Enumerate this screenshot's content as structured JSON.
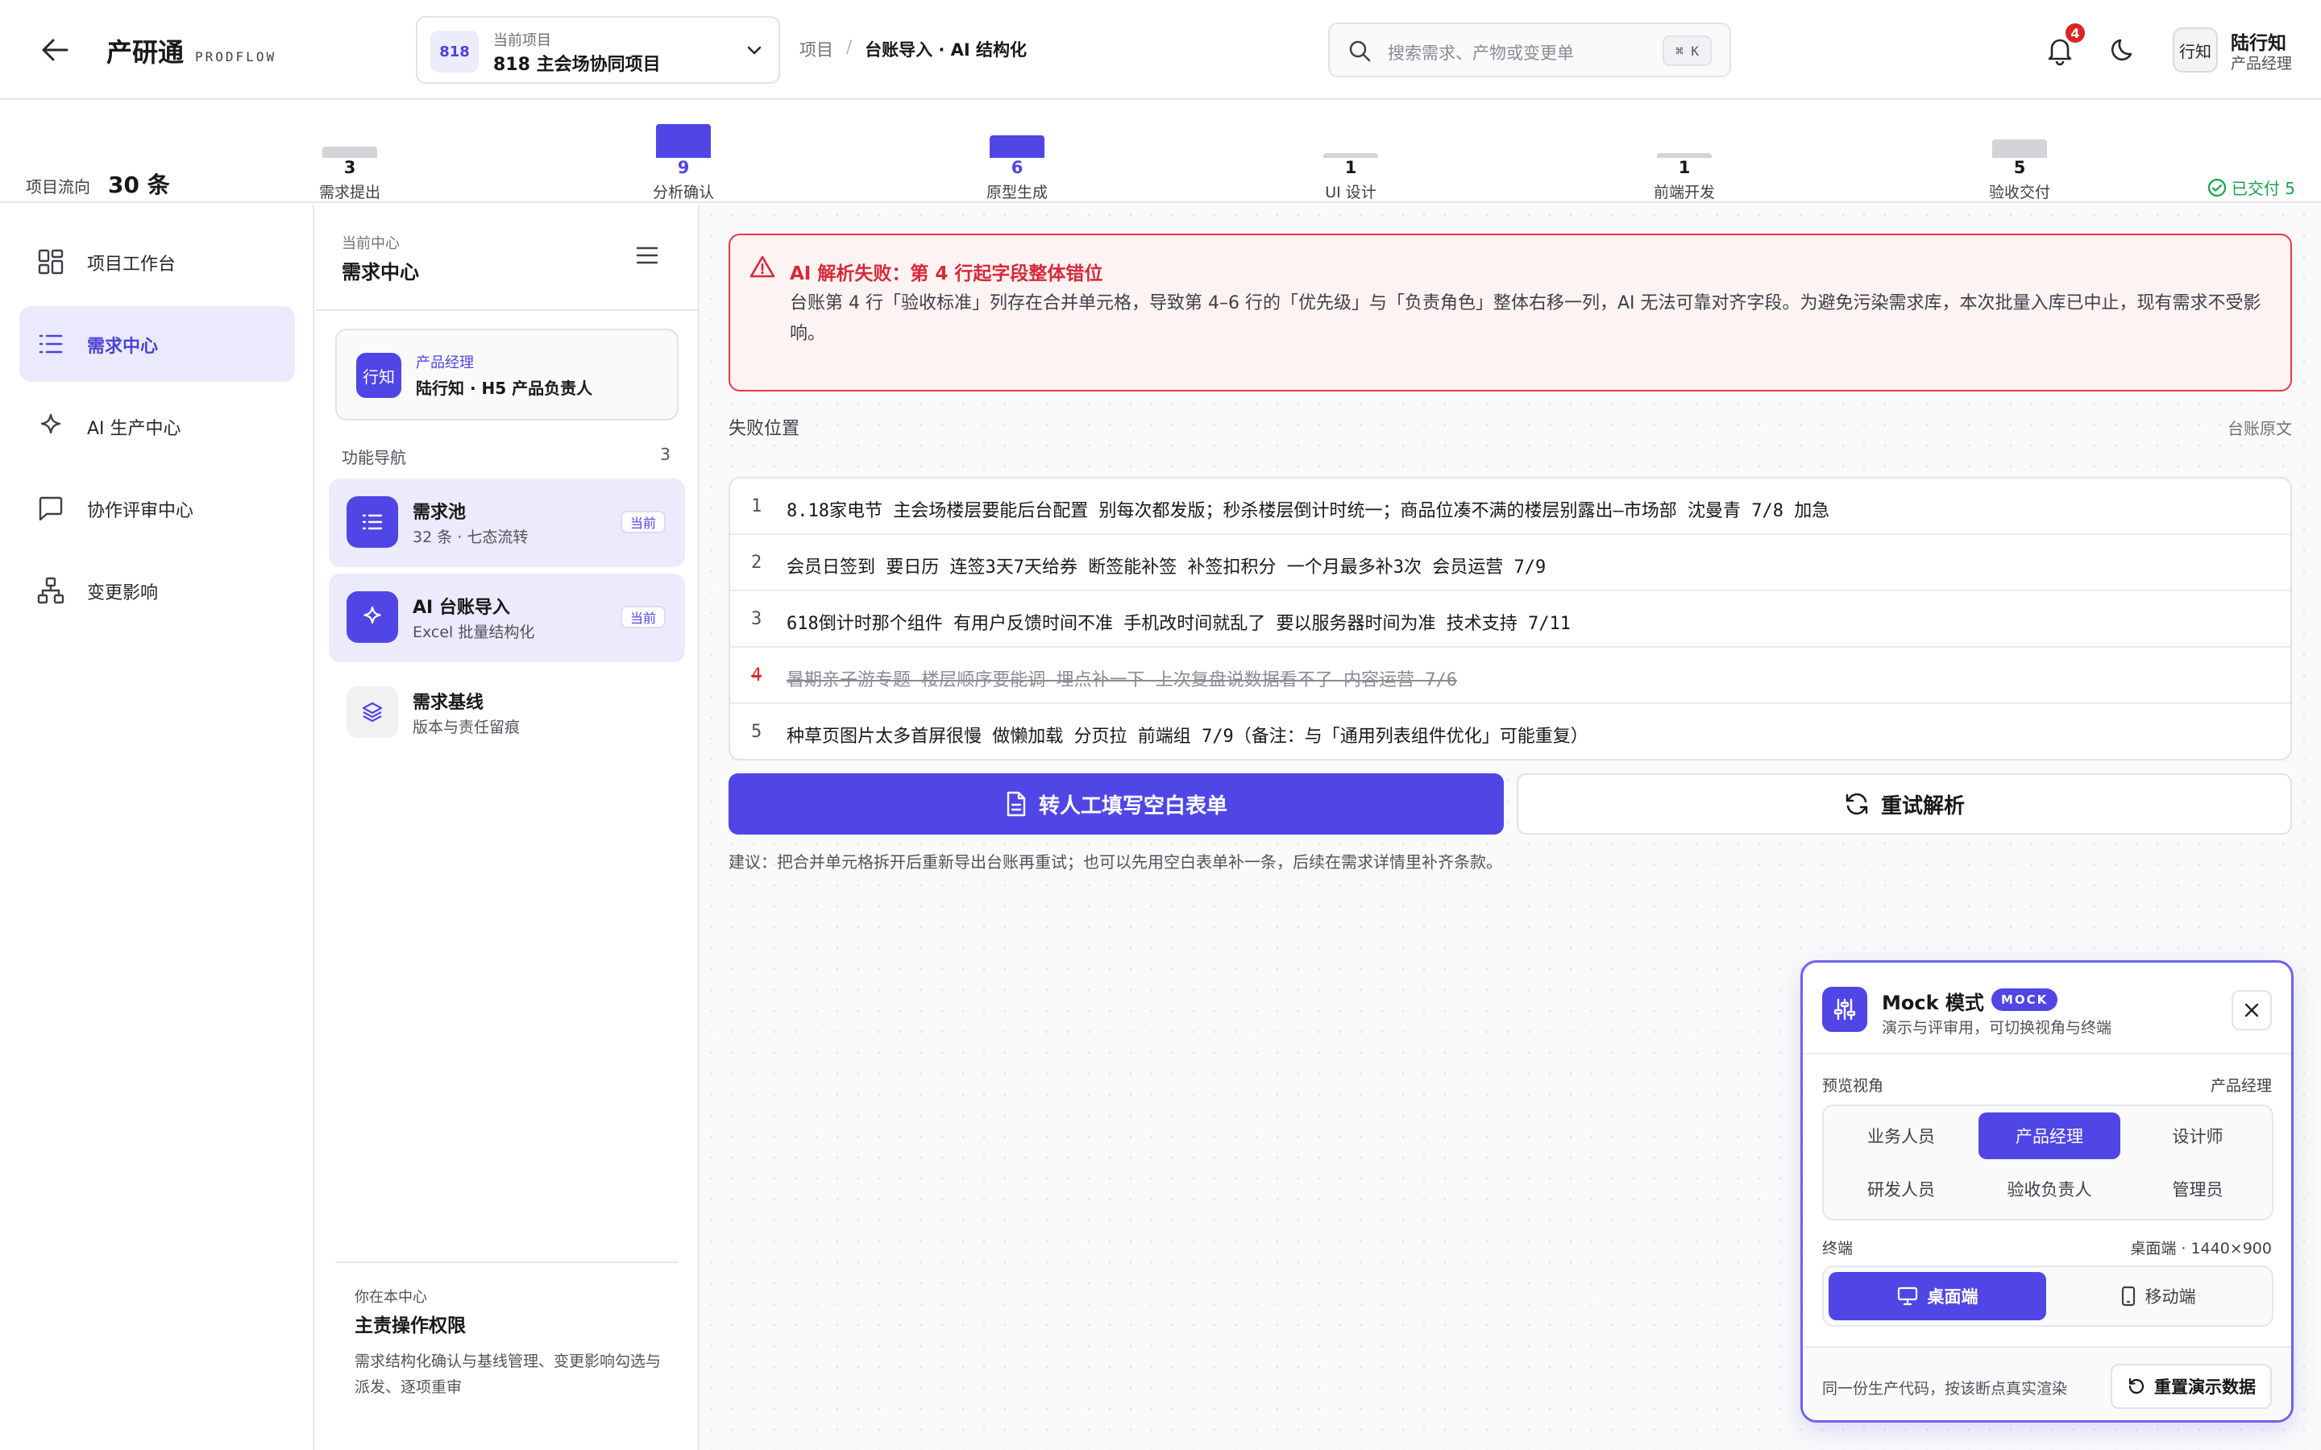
{
  "header": {
    "brand_name": "产研通",
    "brand_sub": "PRODFLOW",
    "project": {
      "badge": "818",
      "label": "当前项目",
      "name": "818 主会场协同项目"
    },
    "breadcrumb": {
      "root": "项目",
      "sep": "/",
      "current": "台账导入 · AI 结构化"
    },
    "search": {
      "placeholder": "搜索需求、产物或变更单",
      "shortcut": "⌘ K"
    },
    "notifications": "4",
    "user": {
      "avatar": "行知",
      "name": "陆行知",
      "role": "产品经理"
    }
  },
  "flow": {
    "title": "项目流向",
    "total": "30 条",
    "stages": [
      {
        "label": "需求提出",
        "count": 3,
        "active": false
      },
      {
        "label": "分析确认",
        "count": 9,
        "active": true
      },
      {
        "label": "原型生成",
        "count": 6,
        "active": true
      },
      {
        "label": "UI 设计",
        "count": 1,
        "active": false
      },
      {
        "label": "前端开发",
        "count": 1,
        "active": false
      },
      {
        "label": "验收交付",
        "count": 5,
        "active": false
      }
    ],
    "delivered": "已交付 5"
  },
  "leftnav": {
    "items": [
      {
        "label": "项目工作台",
        "icon": "dashboard-icon"
      },
      {
        "label": "需求中心",
        "icon": "list-icon"
      },
      {
        "label": "AI 生产中心",
        "icon": "sparkle-icon"
      },
      {
        "label": "协作评审中心",
        "icon": "chat-icon"
      },
      {
        "label": "变更影响",
        "icon": "network-icon"
      }
    ]
  },
  "subnav": {
    "current_label": "当前中心",
    "current_title": "需求中心",
    "role_card": {
      "avatar": "行知",
      "role": "产品经理",
      "desc": "陆行知 · H5 产品负责人"
    },
    "function_title": "功能导航",
    "function_count": "3",
    "items": [
      {
        "title": "需求池",
        "sub": "32 条 · 七态流转",
        "badge": "当前"
      },
      {
        "title": "AI 台账导入",
        "sub": "Excel 批量结构化",
        "badge": "当前"
      },
      {
        "title": "需求基线",
        "sub": "版本与责任留痕"
      }
    ],
    "permission": {
      "label": "你在本中心",
      "title": "主责操作权限",
      "desc": "需求结构化确认与基线管理、变更影响勾选与派发、逐项重审"
    }
  },
  "main": {
    "alert": {
      "title": "AI 解析失败：第 4 行起字段整体错位",
      "body": "台账第 4 行「验收标准」列存在合并单元格，导致第 4–6 行的「优先级」与「负责角色」整体右移一列，AI 无法可靠对齐字段。为避免污染需求库，本次批量入库已中止，现有需求不受影响。"
    },
    "fail_label": "失败位置",
    "raw_label": "台账原文",
    "rows": [
      {
        "num": "1",
        "text": "8.18家电节 主会场楼层要能后台配置 别每次都发版；秒杀楼层倒计时统一；商品位凑不满的楼层别露出—市场部 沈曼青 7/8 加急"
      },
      {
        "num": "2",
        "text": "会员日签到 要日历 连签3天7天给券 断签能补签 补签扣积分 一个月最多补3次 会员运营 7/9"
      },
      {
        "num": "3",
        "text": "618倒计时那个组件 有用户反馈时间不准 手机改时间就乱了 要以服务器时间为准 技术支持 7/11"
      },
      {
        "num": "4",
        "text": "暑期亲子游专题 楼层顺序要能调 埋点补一下 上次复盘说数据看不了 内容运营 7/6"
      },
      {
        "num": "5",
        "text": "种草页图片太多首屏很慢 做懒加载 分页拉 前端组 7/9（备注：与「通用列表组件优化」可能重复）"
      }
    ],
    "primary_button": "转人工填写空白表单",
    "secondary_button": "重试解析",
    "suggestion": "建议：把合并单元格拆开后重新导出台账再重试；也可以先用空白表单补一条，后续在需求详情里补齐条款。"
  },
  "mock": {
    "title": "Mock 模式",
    "tag": "MOCK",
    "subtitle": "演示与评审用，可切换视角与终端",
    "view_label": "预览视角",
    "view_value": "产品经理",
    "roles": [
      "业务人员",
      "产品经理",
      "设计师",
      "研发人员",
      "验收负责人",
      "管理员"
    ],
    "terminal_label": "终端",
    "terminal_value": "桌面端 · 1440×900",
    "terminals": [
      "桌面端",
      "移动端"
    ],
    "footer_text": "同一份生产代码，按该断点真实渲染",
    "reset_button": "重置演示数据"
  },
  "colors": {
    "accent": "#5046e5",
    "danger": "#dc2626",
    "success": "#16a34a"
  }
}
